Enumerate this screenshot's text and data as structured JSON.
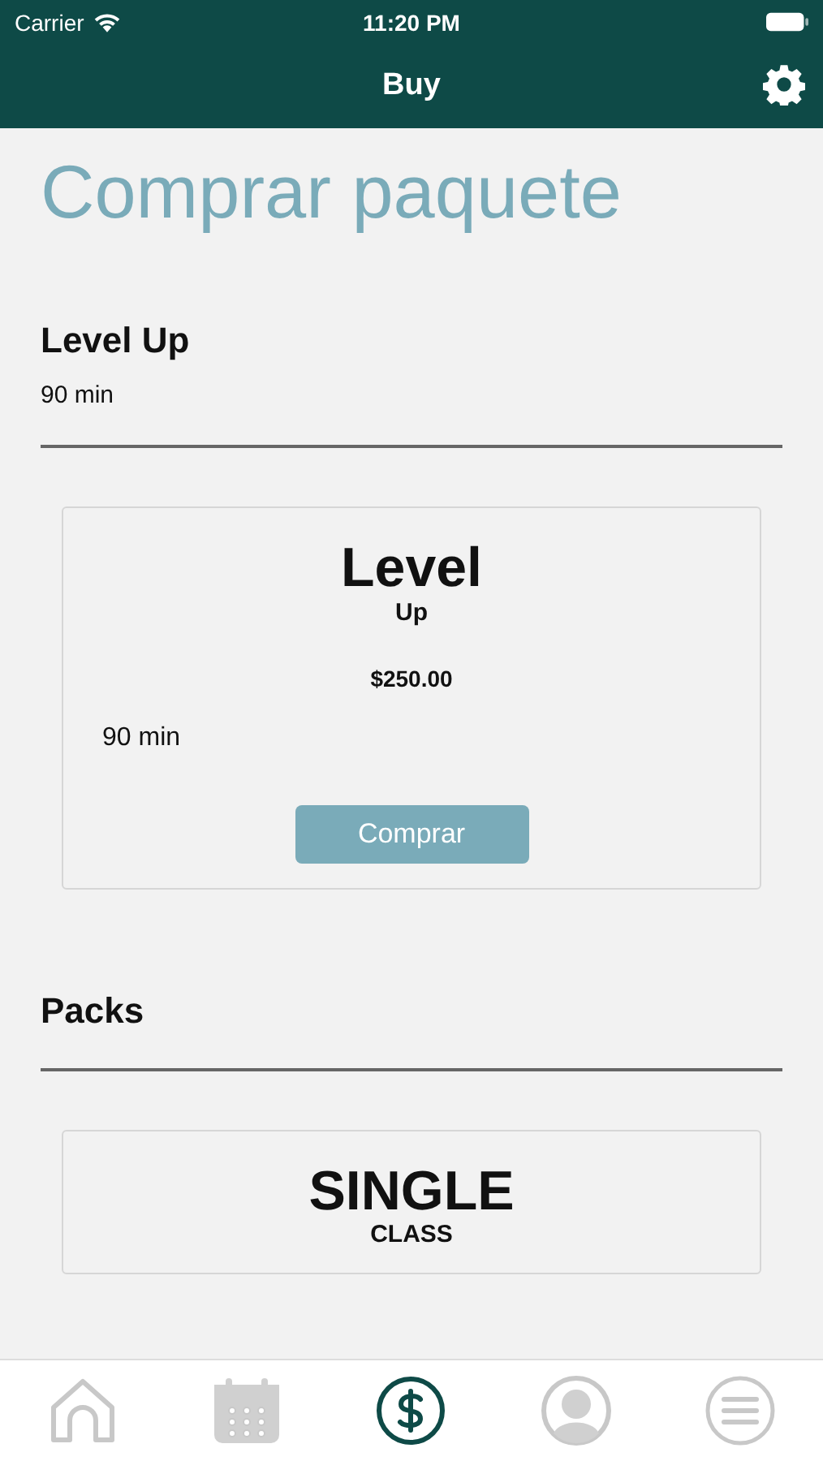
{
  "status_bar": {
    "carrier": "Carrier",
    "time": "11:20 PM"
  },
  "nav": {
    "title": "Buy"
  },
  "heading": "Comprar paquete",
  "sections": [
    {
      "title": "Level Up",
      "subtitle": "90 min",
      "packages": [
        {
          "name": "Level",
          "subname": "Up",
          "price": "$250.00",
          "duration": "90 min",
          "button": "Comprar"
        }
      ]
    },
    {
      "title": "Packs",
      "packages": [
        {
          "name": "SINGLE",
          "subname": "CLASS"
        }
      ]
    }
  ],
  "tabs": [
    {
      "kind": "home",
      "selected": false
    },
    {
      "kind": "calendar",
      "selected": false
    },
    {
      "kind": "buy",
      "selected": true
    },
    {
      "kind": "profile",
      "selected": false
    },
    {
      "kind": "menu",
      "selected": false
    }
  ]
}
